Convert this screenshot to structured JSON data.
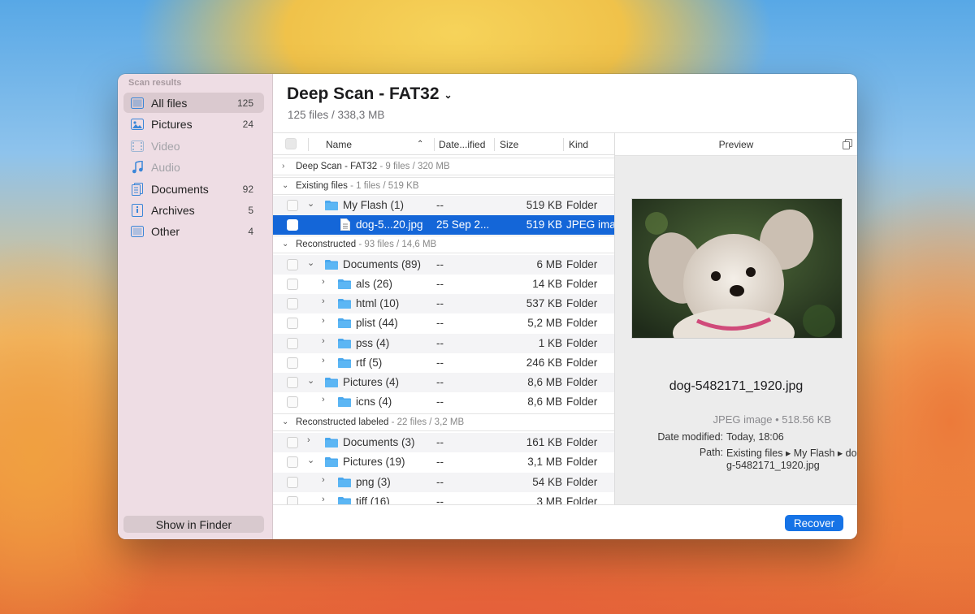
{
  "sidebar": {
    "title": "Scan results",
    "items": [
      {
        "label": "All files",
        "count": "125"
      },
      {
        "label": "Pictures",
        "count": "24"
      },
      {
        "label": "Video",
        "count": ""
      },
      {
        "label": "Audio",
        "count": ""
      },
      {
        "label": "Documents",
        "count": "92"
      },
      {
        "label": "Archives",
        "count": "5"
      },
      {
        "label": "Other",
        "count": "4"
      }
    ],
    "show_in_finder": "Show in Finder"
  },
  "header": {
    "title": "Deep Scan - FAT32",
    "subtitle": "125 files / 338,3 MB"
  },
  "columns": {
    "name": "Name",
    "date": "Date...ified",
    "size": "Size",
    "kind": "Kind"
  },
  "groups": [
    {
      "label": "Deep Scan - FAT32",
      "stats": " - 9 files / 320 MB"
    },
    {
      "label": "Existing files",
      "stats": " - 1 files / 519 KB"
    },
    {
      "label": "Reconstructed",
      "stats": " - 93 files / 14,6 MB"
    },
    {
      "label": "Reconstructed labeled",
      "stats": " - 22 files / 3,2 MB"
    }
  ],
  "rows": [
    {
      "name": "My Flash (1)",
      "date": "--",
      "size": "519 KB",
      "kind": "Folder"
    },
    {
      "name": "dog-5...20.jpg",
      "date": "25 Sep 2...",
      "size": "519 KB",
      "kind": "JPEG ima"
    },
    {
      "name": "Documents (89)",
      "date": "--",
      "size": "6 MB",
      "kind": "Folder"
    },
    {
      "name": "als (26)",
      "date": "--",
      "size": "14 KB",
      "kind": "Folder"
    },
    {
      "name": "html (10)",
      "date": "--",
      "size": "537 KB",
      "kind": "Folder"
    },
    {
      "name": "plist (44)",
      "date": "--",
      "size": "5,2 MB",
      "kind": "Folder"
    },
    {
      "name": "pss (4)",
      "date": "--",
      "size": "1 KB",
      "kind": "Folder"
    },
    {
      "name": "rtf (5)",
      "date": "--",
      "size": "246 KB",
      "kind": "Folder"
    },
    {
      "name": "Pictures (4)",
      "date": "--",
      "size": "8,6 MB",
      "kind": "Folder"
    },
    {
      "name": "icns (4)",
      "date": "--",
      "size": "8,6 MB",
      "kind": "Folder"
    },
    {
      "name": "Documents (3)",
      "date": "--",
      "size": "161 KB",
      "kind": "Folder"
    },
    {
      "name": "Pictures (19)",
      "date": "--",
      "size": "3,1 MB",
      "kind": "Folder"
    },
    {
      "name": "png (3)",
      "date": "--",
      "size": "54 KB",
      "kind": "Folder"
    },
    {
      "name": "tiff (16)",
      "date": "--",
      "size": "3 MB",
      "kind": "Folder"
    }
  ],
  "preview": {
    "header": "Preview",
    "file_name": "dog-5482171_1920.jpg",
    "kind_size": "JPEG image • 518.56 KB",
    "date_label": "Date modified:",
    "date_value": "Today, 18:06",
    "path_label": "Path:",
    "path_line1": "Existing files ▸ My Flash ▸ do",
    "path_line2": "g-5482171_1920.jpg"
  },
  "footer": {
    "recover": "Recover"
  },
  "colors": {
    "accent": "#1466d8",
    "folder": "#4aa8ee",
    "sidebar_bg": "#eedde4"
  }
}
